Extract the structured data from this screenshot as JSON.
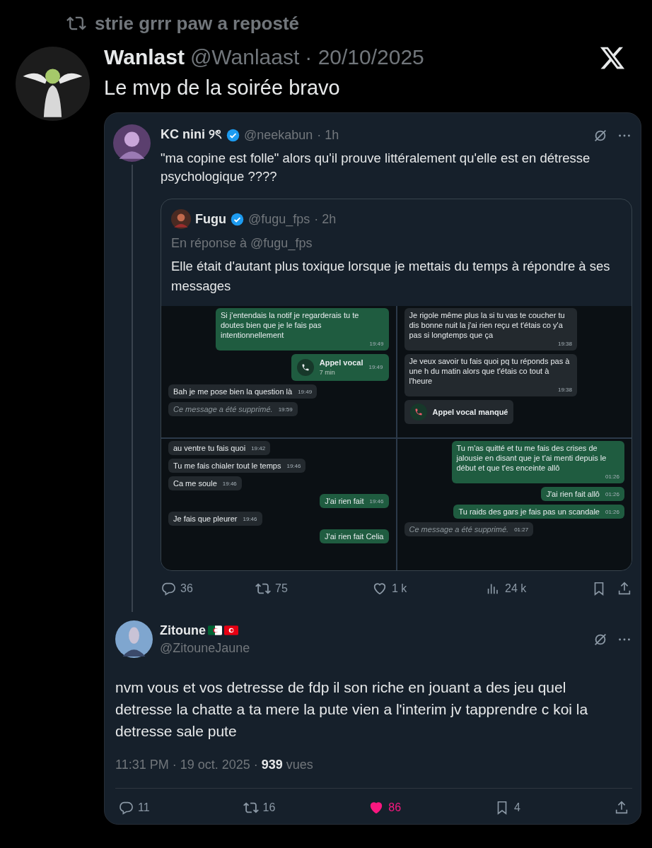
{
  "repost": {
    "label": "strie grrr paw a reposté"
  },
  "tweet": {
    "name": "Wanlast",
    "handle": "@Wanlaast",
    "date": "· 20/10/2025",
    "text": "Le mvp de la soirée bravo"
  },
  "quoted": {
    "name": "KC nini ୨ৎ",
    "verified": true,
    "handle": "@neekabun",
    "time": "· 1h",
    "text": "\"ma copine est folle\" alors qu'il prouve littéralement qu'elle est en détresse psychologique ????",
    "inner": {
      "name": "Fugu",
      "verified": true,
      "handle": "@fugu_fps",
      "time": "· 2h",
      "reply_to": "En réponse à @fugu_fps",
      "text": "Elle était d'autant plus toxique lorsque je mettais du temps à répondre à ses messages",
      "chat_panels": [
        {
          "messages": [
            {
              "kind": "text",
              "outgoing": true,
              "text": "Si j'entendais la notif je regarderais tu te doutes bien que je le fais pas intentionnellement",
              "time": "19:49"
            },
            {
              "kind": "call",
              "outgoing": true,
              "text": "Appel vocal",
              "sub": "7 min",
              "time": "19:49"
            },
            {
              "kind": "text",
              "outgoing": false,
              "text": "Bah je me pose bien la question là",
              "time": "19:49"
            },
            {
              "kind": "deleted",
              "outgoing": false,
              "text": "Ce message a été supprimé.",
              "time": "19:59"
            }
          ]
        },
        {
          "messages": [
            {
              "kind": "text",
              "outgoing": false,
              "text": "Je rigole même plus la si tu vas te coucher tu dis bonne nuit la j'ai rien reçu et t'étais co y'a pas si longtemps que ça",
              "time": "19:38"
            },
            {
              "kind": "text",
              "outgoing": false,
              "text": "Je veux savoir tu fais quoi pq tu réponds pas à une h du matin alors que t'étais co tout à l'heure",
              "time": "19:38"
            },
            {
              "kind": "missed",
              "outgoing": false,
              "text": "Appel vocal manqué"
            }
          ]
        },
        {
          "messages": [
            {
              "kind": "text",
              "outgoing": false,
              "text": "au ventre tu fais quoi",
              "time": "19:42"
            },
            {
              "kind": "text",
              "outgoing": false,
              "text": "Tu me fais chialer tout le temps",
              "time": "19:46"
            },
            {
              "kind": "text",
              "outgoing": false,
              "text": "Ca me soule",
              "time": "19:46"
            },
            {
              "kind": "text",
              "outgoing": true,
              "text": "J'ai rien fait",
              "time": "19:46"
            },
            {
              "kind": "text",
              "outgoing": false,
              "text": "Je fais que pleurer",
              "time": "19:46"
            },
            {
              "kind": "text",
              "outgoing": true,
              "text": "J'ai rien fait Celia"
            }
          ]
        },
        {
          "messages": [
            {
              "kind": "text",
              "outgoing": true,
              "text": "Tu m'as quitté et tu me fais des crises de jalousie en disant que je t'ai menti depuis le début et que t'es enceinte allô",
              "time": "01:26"
            },
            {
              "kind": "text",
              "outgoing": true,
              "text": "J'ai rien fait allô",
              "time": "01:26"
            },
            {
              "kind": "text",
              "outgoing": true,
              "text": "Tu raids des gars je fais pas un scandale",
              "time": "01:26"
            },
            {
              "kind": "deleted",
              "outgoing": false,
              "text": "Ce message a été supprimé.",
              "time": "01:27"
            }
          ]
        }
      ]
    },
    "actions": [
      {
        "kind": "reply",
        "count": "36",
        "active": false
      },
      {
        "kind": "repost",
        "count": "75",
        "active": false
      },
      {
        "kind": "like",
        "count": "1 k",
        "active": false
      },
      {
        "kind": "views",
        "count": "24 k",
        "active": false
      },
      {
        "kind": "bookmark",
        "active": false
      },
      {
        "kind": "share",
        "active": false
      }
    ]
  },
  "reply": {
    "name": "Zitoune",
    "handle": "@ZitouneJaune",
    "text": "nvm vous et vos detresse de fdp il son riche en jouant a des jeu quel detresse la chatte a ta mere la pute vien a l'interim jv tapprendre c koi la detresse sale pute",
    "meta": "11:31 PM · 19 oct. 2025 · **939** vues",
    "actions": [
      {
        "kind": "reply",
        "count": "11",
        "active": false
      },
      {
        "kind": "repost",
        "count": "16",
        "active": false
      },
      {
        "kind": "like",
        "count": "86",
        "active": true
      },
      {
        "kind": "bookmark",
        "count": "4",
        "active": false
      },
      {
        "kind": "share",
        "active": false
      }
    ]
  }
}
